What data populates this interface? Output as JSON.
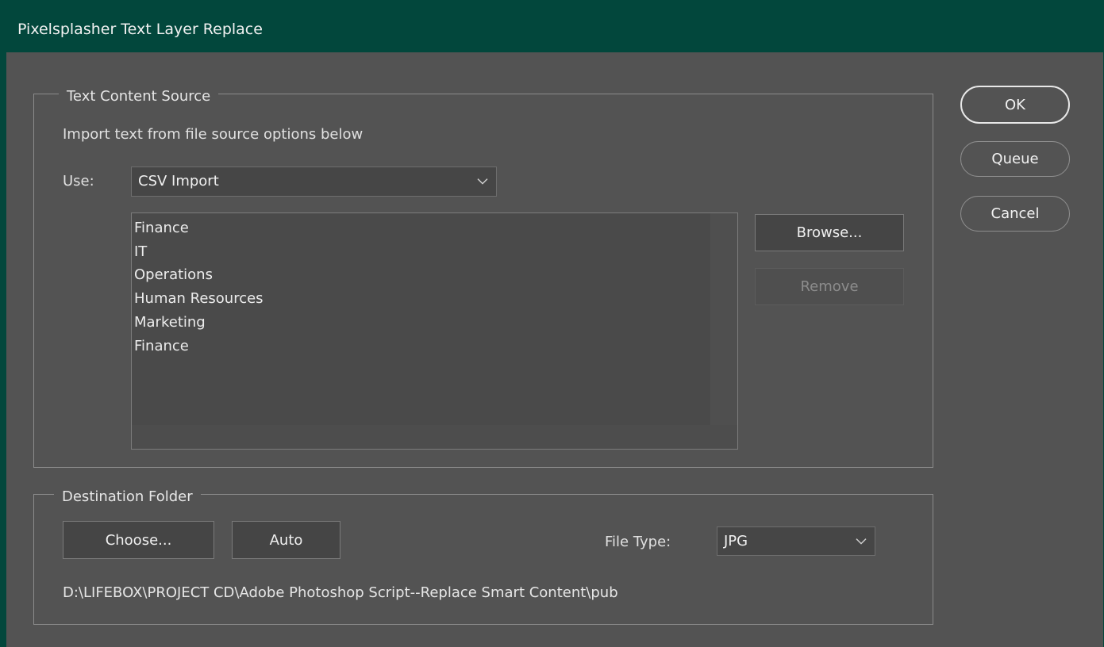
{
  "window": {
    "title": "Pixelsplasher Text Layer Replace"
  },
  "text_source": {
    "legend": "Text Content Source",
    "instruction": "Import text from file source options below",
    "use_label": "Use:",
    "use_selected": "CSV Import",
    "items": [
      "Finance",
      "IT",
      "Operations",
      "Human Resources",
      "Marketing",
      "Finance"
    ],
    "browse_label": "Browse...",
    "remove_label": "Remove"
  },
  "destination": {
    "legend": "Destination Folder",
    "choose_label": "Choose...",
    "auto_label": "Auto",
    "file_type_label": "File Type:",
    "file_type_selected": "JPG",
    "path": "D:\\LIFEBOX\\PROJECT CD\\Adobe Photoshop Script--Replace Smart Content\\pub"
  },
  "actions": {
    "ok_label": "OK",
    "queue_label": "Queue",
    "cancel_label": "Cancel"
  },
  "icons": {
    "dropdown": "chevron-down-icon"
  }
}
